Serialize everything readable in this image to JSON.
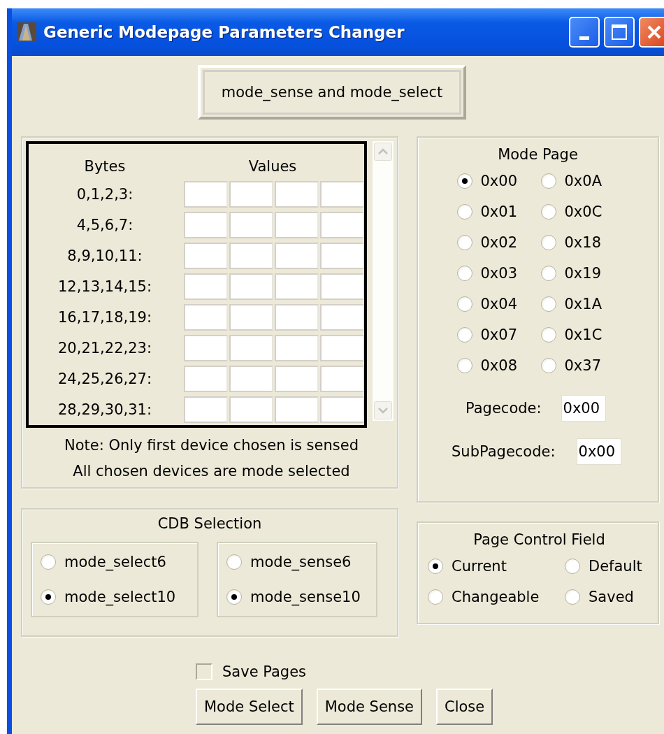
{
  "window": {
    "title": "Generic Modepage Parameters Changer"
  },
  "top_button": "mode_sense and mode_select",
  "bytes_table": {
    "columns": [
      "Bytes",
      "Values"
    ],
    "rows": [
      {
        "bytes": "0,1,2,3:"
      },
      {
        "bytes": "4,5,6,7:"
      },
      {
        "bytes": "8,9,10,11:"
      },
      {
        "bytes": "12,13,14,15:"
      },
      {
        "bytes": "16,17,18,19:"
      },
      {
        "bytes": "20,21,22,23:"
      },
      {
        "bytes": "24,25,26,27:"
      },
      {
        "bytes": "28,29,30,31:"
      }
    ]
  },
  "notes": [
    "Note: Only first device chosen is sensed",
    "All chosen devices are mode selected"
  ],
  "mode_page": {
    "title": "Mode Page",
    "options": [
      {
        "label": "0x00",
        "selected": true
      },
      {
        "label": "0x0A",
        "selected": false
      },
      {
        "label": "0x01",
        "selected": false
      },
      {
        "label": "0x0C",
        "selected": false
      },
      {
        "label": "0x02",
        "selected": false
      },
      {
        "label": "0x18",
        "selected": false
      },
      {
        "label": "0x03",
        "selected": false
      },
      {
        "label": "0x19",
        "selected": false
      },
      {
        "label": "0x04",
        "selected": false
      },
      {
        "label": "0x1A",
        "selected": false
      },
      {
        "label": "0x07",
        "selected": false
      },
      {
        "label": "0x1C",
        "selected": false
      },
      {
        "label": "0x08",
        "selected": false
      },
      {
        "label": "0x37",
        "selected": false
      }
    ],
    "pagecode": {
      "label": "Pagecode:",
      "value": "0x00"
    },
    "subpagecode": {
      "label": "SubPagecode:",
      "value": "0x00"
    }
  },
  "cdb_selection": {
    "title": "CDB Selection",
    "groups": [
      {
        "options": [
          {
            "label": "mode_select6",
            "selected": false
          },
          {
            "label": "mode_select10",
            "selected": true
          }
        ]
      },
      {
        "options": [
          {
            "label": "mode_sense6",
            "selected": false
          },
          {
            "label": "mode_sense10",
            "selected": true
          }
        ]
      }
    ]
  },
  "page_control_field": {
    "title": "Page Control Field",
    "options": [
      {
        "label": "Current",
        "selected": true
      },
      {
        "label": "Default",
        "selected": false
      },
      {
        "label": "Changeable",
        "selected": false
      },
      {
        "label": "Saved",
        "selected": false
      }
    ]
  },
  "save_pages": {
    "label": "Save Pages",
    "checked": false
  },
  "buttons": [
    "Mode Select",
    "Mode Sense",
    "Close"
  ]
}
